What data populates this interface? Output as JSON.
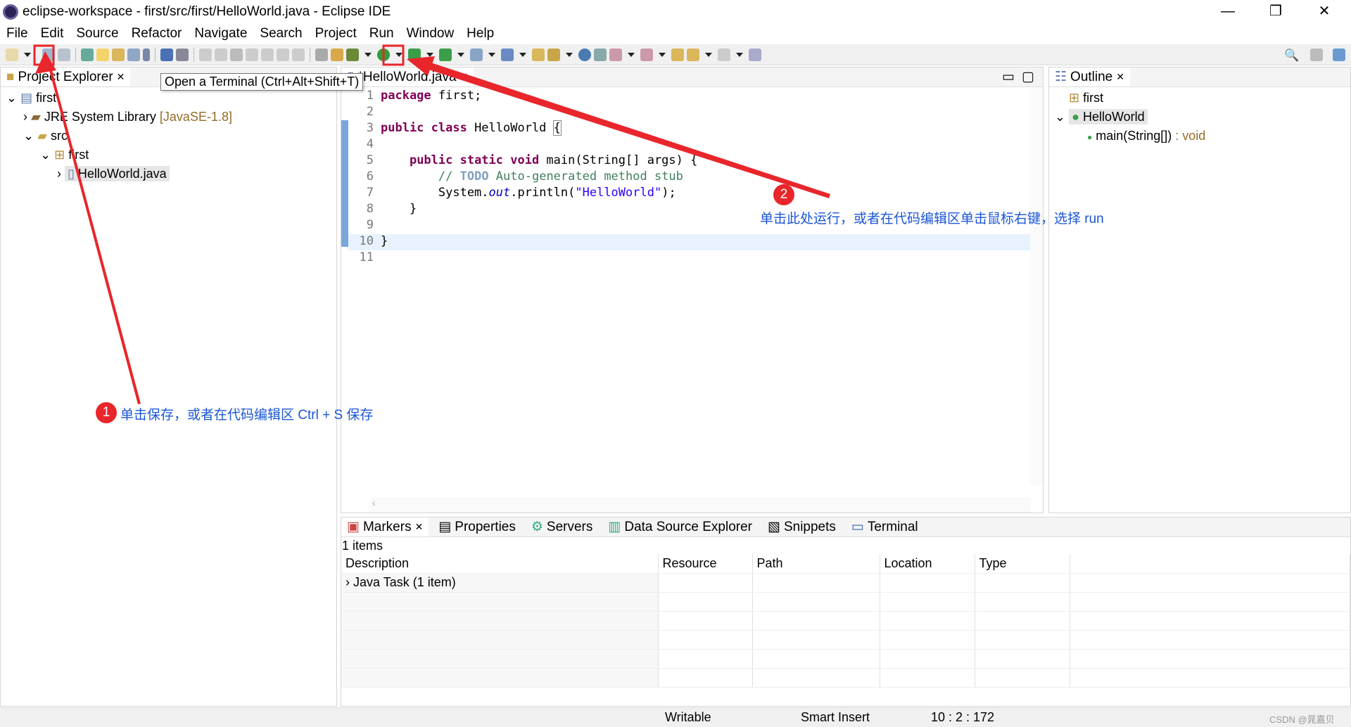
{
  "window": {
    "title": "eclipse-workspace - first/src/first/HelloWorld.java - Eclipse IDE",
    "minimize": "—",
    "restore": "❐",
    "close": "✕"
  },
  "menu": [
    "File",
    "Edit",
    "Source",
    "Refactor",
    "Navigate",
    "Search",
    "Project",
    "Run",
    "Window",
    "Help"
  ],
  "tooltip": "Open a Terminal (Ctrl+Alt+Shift+T)",
  "explorer": {
    "tab": "Project Explorer",
    "tree": [
      {
        "label": "first"
      },
      {
        "label": "JRE System Library",
        "suffix": "[JavaSE-1.8]"
      },
      {
        "label": "src"
      },
      {
        "label": "first"
      },
      {
        "label": "HelloWorld.java"
      }
    ]
  },
  "editor": {
    "tab": "*HelloWorld.java",
    "lines": [
      {
        "n": "1",
        "html": "<span class='kw'>package</span> first;"
      },
      {
        "n": "2",
        "html": ""
      },
      {
        "n": "3",
        "html": "<span class='kw'>public class</span> HelloWorld <span style='outline:1px solid #888'>{</span>"
      },
      {
        "n": "4",
        "html": ""
      },
      {
        "n": "5",
        "html": "    <span class='kw'>public static void</span> main(String[] args) {"
      },
      {
        "n": "6",
        "html": "        <span class='cm'>// <span class='td'>TODO</span> Auto-generated method stub</span>"
      },
      {
        "n": "7",
        "html": "        System.<span class='fi'>out</span>.println(<span class='st'>\"HelloWorld\"</span>);"
      },
      {
        "n": "8",
        "html": "    }"
      },
      {
        "n": "9",
        "html": ""
      },
      {
        "n": "10",
        "html": "}"
      },
      {
        "n": "11",
        "html": ""
      }
    ]
  },
  "outline": {
    "tab": "Outline",
    "items": [
      {
        "label": "first"
      },
      {
        "label": "HelloWorld"
      },
      {
        "label": "main(String[])",
        "suffix": " : void"
      }
    ]
  },
  "bottom": {
    "tabs": [
      "Markers",
      "Properties",
      "Servers",
      "Data Source Explorer",
      "Snippets",
      "Terminal"
    ],
    "count": "1 items",
    "columns": [
      "Description",
      "Resource",
      "Path",
      "Location",
      "Type"
    ],
    "rows": [
      {
        "description": "Java Task (1 item)"
      }
    ]
  },
  "status": {
    "writable": "Writable",
    "insert": "Smart Insert",
    "position": "10 : 2 : 172",
    "watermark": "CSDN @晁嘉贝"
  },
  "annotations": {
    "step1_num": "1",
    "step1": "单击保存，或者在代码编辑区 Ctrl + S 保存",
    "step2_num": "2",
    "step2": "单击此处运行，或者在代码编辑区单击鼠标右键，选择 run",
    "color": "#e8262b"
  }
}
